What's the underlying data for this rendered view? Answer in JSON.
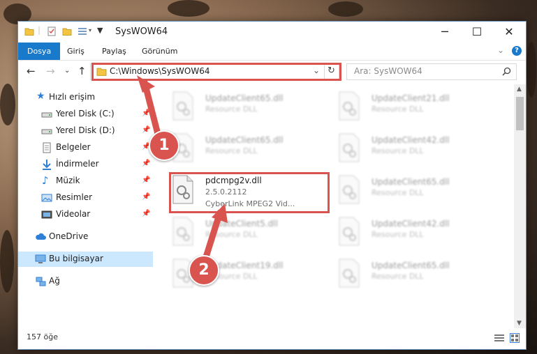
{
  "window": {
    "title": "SysWOW64",
    "minimize": "─",
    "maximize": "☐",
    "close": "✕"
  },
  "ribbon": {
    "tabs": [
      {
        "label": "Dosya"
      },
      {
        "label": "Giriş"
      },
      {
        "label": "Paylaş"
      },
      {
        "label": "Görünüm"
      }
    ],
    "expand": "⌄",
    "help": "?"
  },
  "address": {
    "path": "C:\\Windows\\SysWOW64",
    "search_placeholder": "Ara: SysWOW64"
  },
  "nav": {
    "quick_access": "Hızlı erişim",
    "items": [
      {
        "label": "Yerel Disk (C:)",
        "icon": "drive-icon"
      },
      {
        "label": "Yerel Disk (D:)",
        "icon": "drive-icon"
      },
      {
        "label": "Belgeler",
        "icon": "documents-icon"
      },
      {
        "label": "İndirmeler",
        "icon": "download-icon"
      },
      {
        "label": "Müzik",
        "icon": "music-icon"
      },
      {
        "label": "Resimler",
        "icon": "pictures-icon"
      },
      {
        "label": "Videolar",
        "icon": "videos-icon"
      }
    ],
    "onedrive": "OneDrive",
    "this_pc": "Bu bilgisayar",
    "network": "Ağ"
  },
  "files": {
    "left_column": [
      {
        "name": "UpdateClient65.dll",
        "desc": "Resource DLL"
      },
      {
        "name": "UpdateClient65.dll",
        "desc": "Resource DLL"
      },
      {
        "name": "UpdateClient5.dll",
        "desc": "Resource DLL"
      },
      {
        "name": "UpdateClient19.dll",
        "desc": "Resource DLL"
      }
    ],
    "right_column": [
      {
        "name": "UpdateClient21.dll",
        "desc": "Resource DLL"
      },
      {
        "name": "UpdateClient42.dll",
        "desc": "Resource DLL"
      },
      {
        "name": "UpdateClient65.dll",
        "desc": "Resource DLL"
      },
      {
        "name": "UpdateClient42.dll",
        "desc": "Resource DLL"
      },
      {
        "name": "UpdateClient65.dll",
        "desc": "Resource DLL"
      }
    ],
    "highlighted": {
      "name": "pdcmpg2v.dll",
      "version": "2.5.0.2112",
      "desc": "CyberLink MPEG2 Vid..."
    }
  },
  "status": {
    "count": "157 öğe"
  },
  "callouts": {
    "one": "1",
    "two": "2"
  },
  "colors": {
    "accent": "#1979ca",
    "highlight": "#d9534f",
    "selection": "#cce8ff"
  }
}
